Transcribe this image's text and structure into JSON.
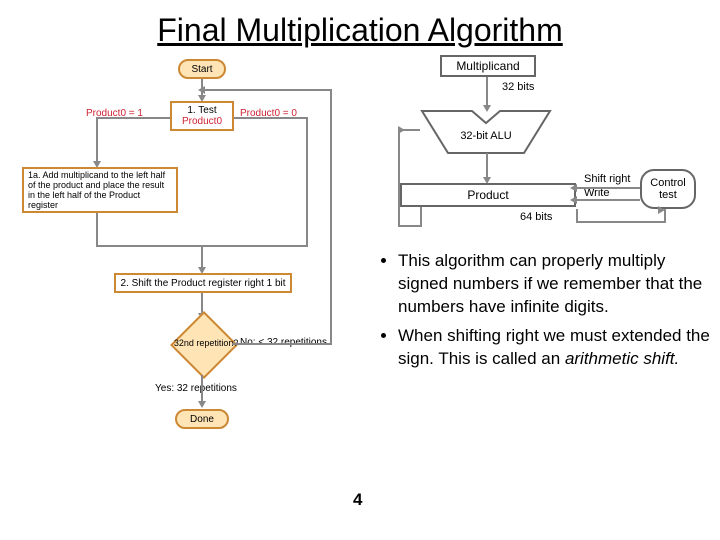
{
  "title": "Final Multiplication Algorithm",
  "flowchart": {
    "start": "Start",
    "test": "1. Test",
    "test_label": "Product0",
    "branch_left": "Product0 = 1",
    "branch_right": "Product0 = 0",
    "step1a": "1a. Add multiplicand to the left half of the product and place the result in the left half of the Product register",
    "step2": "2. Shift the Product register right 1 bit",
    "decision": "32nd repetition?",
    "no": "No: < 32 repetitions",
    "yes": "Yes: 32 repetitions",
    "done": "Done"
  },
  "datapath": {
    "multiplicand": "Multiplicand",
    "bits32": "32 bits",
    "alu": "32-bit ALU",
    "product": "Product",
    "shift": "Shift right",
    "write": "Write",
    "bits64": "64 bits",
    "control": "Control test"
  },
  "bullets": {
    "b1a": "This algorithm can properly multiply signed numbers if we remember that the numbers have infinite digits.",
    "b2a": "When shifting right we must extended the sign. This is called an ",
    "b2b": "arithmetic shift."
  },
  "page": "4"
}
